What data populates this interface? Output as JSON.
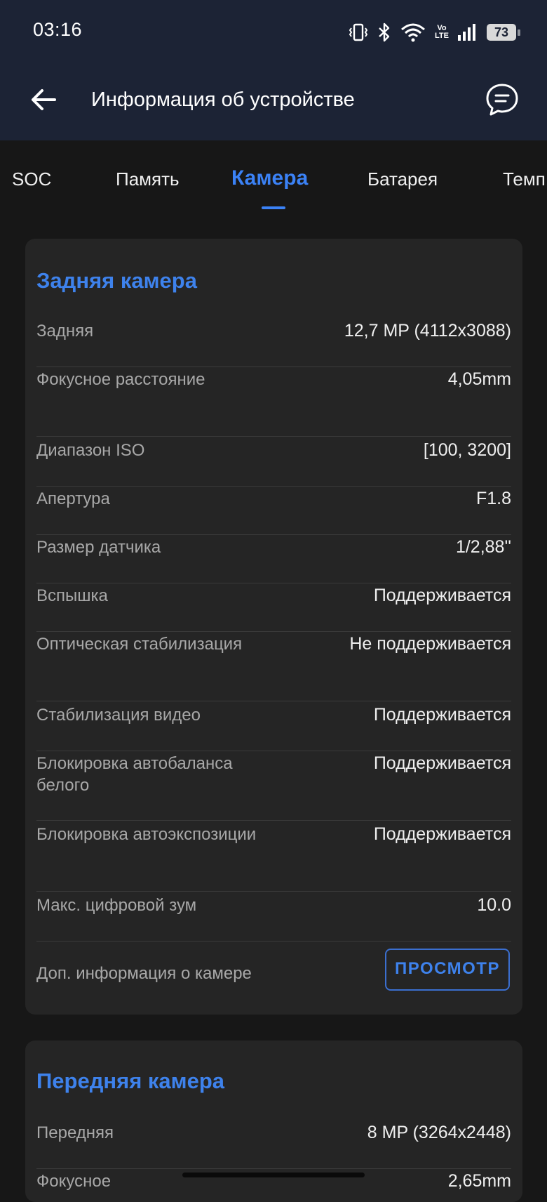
{
  "status_bar": {
    "time": "03:16",
    "battery": "73"
  },
  "app_bar": {
    "title": "Информация об устройстве"
  },
  "tabs": [
    {
      "label": "SOC"
    },
    {
      "label": "Память"
    },
    {
      "label": "Камера"
    },
    {
      "label": "Батарея"
    },
    {
      "label": "Темп"
    }
  ],
  "active_tab": "Камера",
  "rear_camera": {
    "title": "Задняя камера",
    "rows": [
      {
        "label": "Задняя",
        "value": "12,7 MP (4112x3088)"
      },
      {
        "label": "Фокусное расстояние",
        "value": "4,05mm"
      },
      {
        "label": "Диапазон ISO",
        "value": "[100, 3200]"
      },
      {
        "label": "Апертура",
        "value": "F1.8"
      },
      {
        "label": "Размер датчика",
        "value": "1/2,88''"
      },
      {
        "label": "Вспышка",
        "value": "Поддерживается"
      },
      {
        "label": "Оптическая стабилизация",
        "value": "Не поддерживается"
      },
      {
        "label": "Стабилизация видео",
        "value": "Поддерживается"
      },
      {
        "label": "Блокировка автобаланса белого",
        "value": "Поддерживается"
      },
      {
        "label": "Блокировка автоэкспозиции",
        "value": "Поддерживается"
      },
      {
        "label": "Макс. цифровой зум",
        "value": "10.0"
      }
    ],
    "more_info_label": "Доп. информация о камере",
    "view_button": "ПРОСМОТР"
  },
  "front_camera": {
    "title": "Передняя камера",
    "rows": [
      {
        "label": "Передняя",
        "value": "8 MP (3264x2448)"
      },
      {
        "label": "Фокусное",
        "value": "2,65mm"
      }
    ]
  },
  "colors": {
    "accent": "#3e82ec",
    "app_bar": "#1c2335",
    "card": "#252525",
    "background": "#171717"
  },
  "icons": [
    "vibrate-icon",
    "bluetooth-icon",
    "wifi-icon",
    "volte-icon",
    "signal-icon",
    "battery-icon",
    "back-arrow-icon",
    "feedback-chat-icon"
  ]
}
